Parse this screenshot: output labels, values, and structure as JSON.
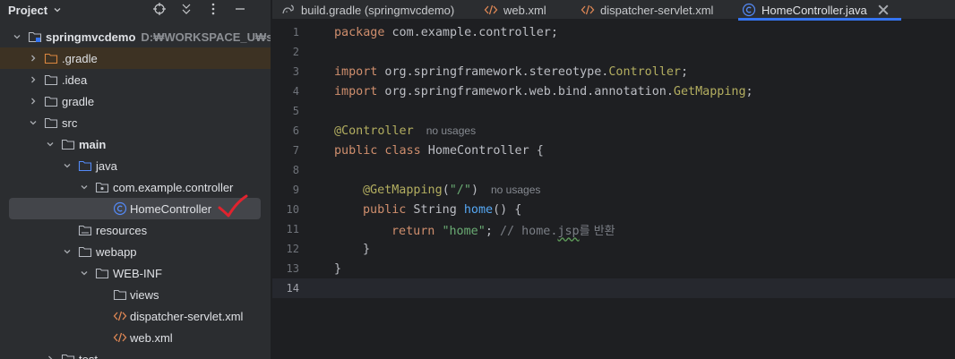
{
  "project": {
    "title": "Project",
    "tree": [
      {
        "label": "springmvcdemo",
        "path": "D:₩WORKSPACE_U₩springm",
        "depth": 0,
        "expanded": true,
        "bold": true,
        "icon": "module-folder-icon"
      },
      {
        "label": ".gradle",
        "depth": 1,
        "expanded": false,
        "icon": "folder-orange-icon",
        "highlight": "orange"
      },
      {
        "label": ".idea",
        "depth": 1,
        "expanded": false,
        "icon": "folder-icon"
      },
      {
        "label": "gradle",
        "depth": 1,
        "expanded": false,
        "icon": "folder-icon"
      },
      {
        "label": "src",
        "depth": 1,
        "expanded": true,
        "icon": "folder-icon"
      },
      {
        "label": "main",
        "depth": 2,
        "expanded": true,
        "bold": true,
        "icon": "folder-icon"
      },
      {
        "label": "java",
        "depth": 3,
        "expanded": true,
        "icon": "source-folder-icon"
      },
      {
        "label": "com.example.controller",
        "depth": 4,
        "expanded": true,
        "icon": "package-icon"
      },
      {
        "label": "HomeController",
        "depth": 5,
        "icon": "class-icon",
        "selected": true
      },
      {
        "label": "resources",
        "depth": 3,
        "icon": "resources-folder-icon"
      },
      {
        "label": "webapp",
        "depth": 3,
        "expanded": true,
        "icon": "folder-icon"
      },
      {
        "label": "WEB-INF",
        "depth": 4,
        "expanded": true,
        "icon": "folder-icon"
      },
      {
        "label": "views",
        "depth": 5,
        "icon": "folder-icon"
      },
      {
        "label": "dispatcher-servlet.xml",
        "depth": 5,
        "icon": "xml-icon"
      },
      {
        "label": "web.xml",
        "depth": 5,
        "icon": "xml-icon"
      },
      {
        "label": "test",
        "depth": 2,
        "expanded": false,
        "icon": "folder-icon"
      }
    ]
  },
  "tabs": [
    {
      "label": "build.gradle (springmvcdemo)",
      "icon": "gradle-icon"
    },
    {
      "label": "web.xml",
      "icon": "xml-icon"
    },
    {
      "label": "dispatcher-servlet.xml",
      "icon": "xml-icon"
    },
    {
      "label": "HomeController.java",
      "icon": "class-icon",
      "active": true
    }
  ],
  "editor": {
    "line_numbers": [
      "1",
      "2",
      "3",
      "4",
      "5",
      "6",
      "7",
      "8",
      "9",
      "10",
      "11",
      "12",
      "13",
      "14"
    ],
    "current_line": "14",
    "code": {
      "l1_kw": "package",
      "l1_rest": " com.example.controller;",
      "l3_kw": "import",
      "l3_pkg": " org.springframework.stereotype.",
      "l3_name": "Controller",
      "l3_end": ";",
      "l4_kw": "import",
      "l4_pkg": " org.springframework.web.bind.annotation.",
      "l4_name": "GetMapping",
      "l4_end": ";",
      "l6_ann": "@Controller",
      "l6_hint": "no usages",
      "l7_kw": "public class",
      "l7_name": " HomeController",
      "l7_end": " {",
      "l9_ann": "@GetMapping",
      "l9_p1": "(",
      "l9_str": "\"/\"",
      "l9_p2": ")",
      "l9_hint": "no usages",
      "l10_kw": "public",
      "l10_type": " String ",
      "l10_fn": "home",
      "l10_end": "() {",
      "l11_kw": "return",
      "l11_sp": " ",
      "l11_str": "\"home\"",
      "l11_semi": "; ",
      "l11_c1": "// home.",
      "l11_c2": "jsp",
      "l11_c3": "를 반환",
      "l12": "}",
      "l13": "}"
    }
  },
  "colors": {
    "accent": "#3574f0",
    "annotation_mark": "#e0232e"
  }
}
